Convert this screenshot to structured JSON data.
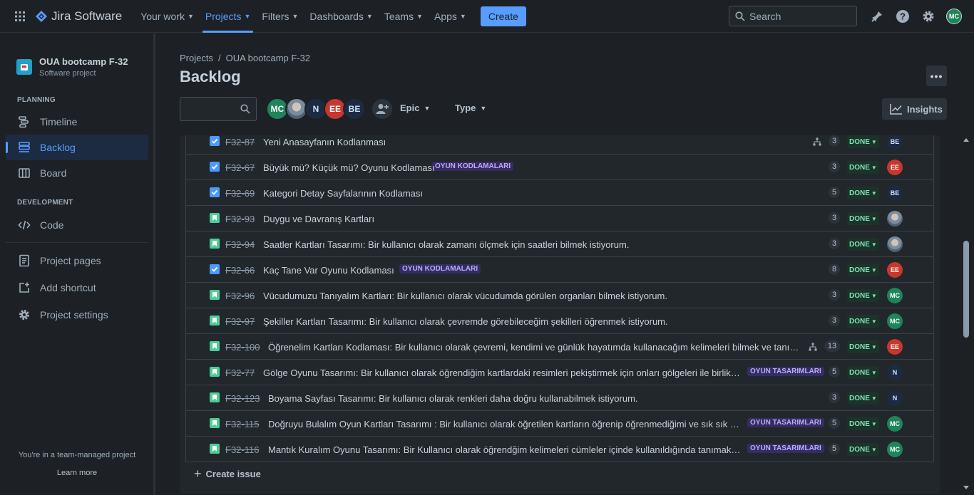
{
  "app": {
    "name": "Jira Software"
  },
  "topnav": {
    "items": [
      {
        "label": "Your work"
      },
      {
        "label": "Projects",
        "active": true
      },
      {
        "label": "Filters"
      },
      {
        "label": "Dashboards"
      },
      {
        "label": "Teams"
      },
      {
        "label": "Apps"
      }
    ],
    "create_label": "Create",
    "search_placeholder": "Search",
    "user_initials": "MC"
  },
  "sidebar": {
    "project_name": "OUA bootcamp F-32",
    "project_type": "Software project",
    "planning_heading": "PLANNING",
    "development_heading": "DEVELOPMENT",
    "items": {
      "timeline": "Timeline",
      "backlog": "Backlog",
      "board": "Board",
      "code": "Code",
      "project_pages": "Project pages",
      "add_shortcut": "Add shortcut",
      "project_settings": "Project settings"
    },
    "footer_text": "You're in a team-managed project",
    "learn_more": "Learn more"
  },
  "header": {
    "breadcrumb_root": "Projects",
    "breadcrumb_separator": "/",
    "breadcrumb_project": "OUA bootcamp F-32",
    "title": "Backlog",
    "more_label": "•••"
  },
  "filters": {
    "avatars": [
      {
        "initials": "MC",
        "kind": "mc"
      },
      {
        "initials": "",
        "kind": "photo"
      },
      {
        "initials": "N",
        "kind": "n"
      },
      {
        "initials": "EE",
        "kind": "ee"
      },
      {
        "initials": "BE",
        "kind": "be"
      }
    ],
    "epic_label": "Epic",
    "type_label": "Type",
    "insights_label": "Insights"
  },
  "issues": [
    {
      "type": "task",
      "key": "F32-87",
      "summary": "Yeni Anasayfanın Kodlanması",
      "epic": "",
      "child": true,
      "points": "3",
      "status": "DONE",
      "assignee": "BE",
      "avatar_kind": "be"
    },
    {
      "type": "task",
      "key": "F32-67",
      "summary": "Büyük mü? Küçük mü? Oyunu Kodlaması",
      "epic": "OYUN KODLAMALARI",
      "child": false,
      "points": "3",
      "status": "DONE",
      "assignee": "EE",
      "avatar_kind": "ee"
    },
    {
      "type": "task",
      "key": "F32-69",
      "summary": "Kategori Detay Sayfalarının Kodlaması",
      "epic": "",
      "child": false,
      "points": "5",
      "status": "DONE",
      "assignee": "BE",
      "avatar_kind": "be"
    },
    {
      "type": "story",
      "key": "F32-93",
      "summary": "Duygu ve Davranış Kartları",
      "epic": "",
      "child": false,
      "points": "3",
      "status": "DONE",
      "assignee": "",
      "avatar_kind": "photo"
    },
    {
      "type": "story",
      "key": "F32-94",
      "summary": "Saatler Kartları Tasarımı: Bir kullanıcı olarak zamanı ölçmek için saatleri bilmek istiyorum.",
      "epic": "",
      "child": false,
      "points": "3",
      "status": "DONE",
      "assignee": "",
      "avatar_kind": "photo"
    },
    {
      "type": "task",
      "key": "F32-66",
      "summary": "Kaç Tane Var Oyunu Kodlaması",
      "epic": "OYUN KODLAMALARI",
      "child": false,
      "points": "8",
      "status": "DONE",
      "assignee": "EE",
      "avatar_kind": "ee"
    },
    {
      "type": "story",
      "key": "F32-96",
      "summary": "Vücudumuzu Tanıyalım Kartları: Bir kullanıcı olarak vücudumda görülen organları bilmek istiyorum.",
      "epic": "",
      "child": false,
      "points": "3",
      "status": "DONE",
      "assignee": "MC",
      "avatar_kind": "mc"
    },
    {
      "type": "story",
      "key": "F32-97",
      "summary": "Şekiller Kartları Tasarımı: Bir kullanıcı olarak çevremde görebileceğim şekilleri öğrenmek istiyorum.",
      "epic": "",
      "child": false,
      "points": "3",
      "status": "DONE",
      "assignee": "MC",
      "avatar_kind": "mc"
    },
    {
      "type": "story",
      "key": "F32-100",
      "summary": "Öğrenelim Kartları Kodlaması: Bir kullanıcı olarak çevremi, kendimi ve günlük hayatımda kullanacağım kelimeleri bilmek ve tanımak istiy...",
      "epic": "",
      "child": true,
      "points": "13",
      "status": "DONE",
      "assignee": "EE",
      "avatar_kind": "ee"
    },
    {
      "type": "story",
      "key": "F32-77",
      "summary": "Gölge Oyunu Tasarımı: Bir kullanıcı olarak öğrendiğim kartlardaki resimleri pekiştirmek için onları gölgeleri ile birlikte he...",
      "epic": "OYUN TASARIMLARI",
      "child": false,
      "points": "5",
      "status": "DONE",
      "assignee": "N",
      "avatar_kind": "n"
    },
    {
      "type": "story",
      "key": "F32-123",
      "summary": "Boyama Sayfası Tasarımı: Bir kullanıcı olarak renkleri daha doğru kullanabilmek istiyorum.",
      "epic": "",
      "child": false,
      "points": "3",
      "status": "DONE",
      "assignee": "N",
      "avatar_kind": "n"
    },
    {
      "type": "story",
      "key": "F32-115",
      "summary": "Doğruyu Bulalım Oyun Kartları Tasarımı : Bir kullanıcı olarak öğretilen kartların öğrenip öğrenmediğimi ve sık sık tekrarın...",
      "epic": "OYUN TASARIMLARI",
      "child": false,
      "points": "5",
      "status": "DONE",
      "assignee": "MC",
      "avatar_kind": "mc"
    },
    {
      "type": "story",
      "key": "F32-116",
      "summary": "Mantık Kuralım Oyunu Tasarımı: Bir Kullanıcı olarak öğrendğim kelimeleri cümleler içinde kullanıldığında tanımak istiyor...",
      "epic": "OYUN TASARIMLARI",
      "child": false,
      "points": "5",
      "status": "DONE",
      "assignee": "MC",
      "avatar_kind": "mc"
    }
  ],
  "create_issue_label": "Create issue"
}
